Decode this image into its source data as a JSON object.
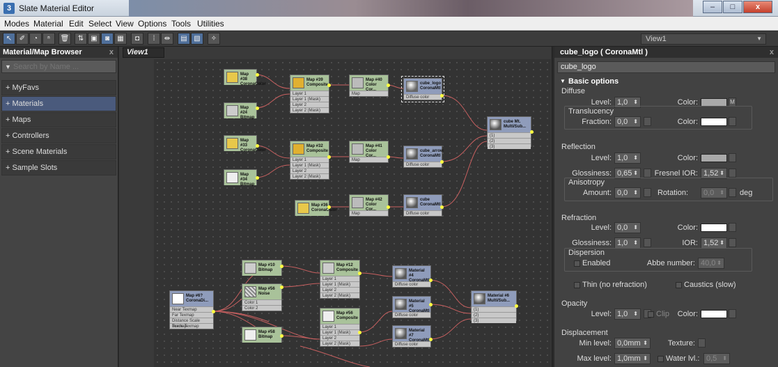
{
  "window": {
    "icon_text": "3",
    "title": "Slate Material Editor",
    "min": "–",
    "max": "□",
    "close": "x"
  },
  "menu": [
    "Modes",
    "Material",
    "Edit",
    "Select",
    "View",
    "Options",
    "Tools",
    "Utilities"
  ],
  "toolbar": {
    "view_selector": "View1"
  },
  "browser": {
    "title": "Material/Map Browser",
    "close": "x",
    "search_placeholder": "Search by Name ...",
    "items": [
      "+ MyFavs",
      "+ Materials",
      "+ Maps",
      "+ Controllers",
      "+ Scene Materials",
      "+ Sample Slots"
    ],
    "selected": 1
  },
  "view": {
    "tab": "View1"
  },
  "nodes": {
    "n1": {
      "title": "Map #38",
      "sub": "CoronaColor"
    },
    "n2": {
      "title": "Map #39",
      "sub": "Composite",
      "rows": [
        "Layer 1",
        "Layer 1 (Mask)",
        "Layer 2",
        "Layer 2 (Mask)"
      ]
    },
    "n3": {
      "title": "Map #40",
      "sub": "Color Cor...",
      "rows": [
        "Map"
      ]
    },
    "n4": {
      "title": "cube_logo",
      "sub": "CoronaMtl",
      "rows": [
        "Diffuse color"
      ]
    },
    "n5": {
      "title": "Map #24",
      "sub": "Bitmap"
    },
    "n6": {
      "title": "cube Mt.",
      "sub": "Multi/Sub...",
      "rows": [
        "(1)",
        "(2)",
        "(3)"
      ]
    },
    "n7": {
      "title": "Map #33",
      "sub": "CoronaColor"
    },
    "n8": {
      "title": "Map #32",
      "sub": "Composite",
      "rows": [
        "Layer 1",
        "Layer 1 (Mask)",
        "Layer 2",
        "Layer 2 (Mask)"
      ]
    },
    "n9": {
      "title": "Map #41",
      "sub": "Color Cor...",
      "rows": [
        "Map"
      ]
    },
    "n10": {
      "title": "cube_arrow",
      "sub": "CoronaMtl",
      "rows": [
        "Diffuse color"
      ]
    },
    "n11": {
      "title": "Map #34",
      "sub": "Bitmap"
    },
    "n12": {
      "title": "Map #42",
      "sub": "Color Cor...",
      "rows": [
        "Map"
      ]
    },
    "n13": {
      "title": "cube",
      "sub": "CoronaMtl",
      "rows": [
        "Diffuse color"
      ]
    },
    "n14": {
      "title": "Map #36",
      "sub": "CoronaColor"
    },
    "n15": {
      "title": "Map #10",
      "sub": "Bitmap"
    },
    "n16": {
      "title": "Map #12",
      "sub": "Composite",
      "rows": [
        "Layer 1",
        "Layer 1 (Mask)",
        "Layer 2",
        "Layer 2 (Mask)"
      ]
    },
    "n17": {
      "title": "Material #4",
      "sub": "CoronaMtl",
      "rows": [
        "Diffuse color"
      ]
    },
    "n18": {
      "title": "Map #6?",
      "sub": "CoronaDi...",
      "rows": [
        "Near Texmap",
        "Far Texmap",
        "Distance Scale Texmap",
        "Inside Texmap"
      ]
    },
    "n19": {
      "title": "Map #56",
      "sub": "Noise",
      "rows": [
        "Color 1",
        "Color 2"
      ]
    },
    "n20": {
      "title": "Material #5",
      "sub": "CoronaMtl",
      "rows": [
        "Diffuse color"
      ]
    },
    "n21": {
      "title": "Material #6",
      "sub": "Multi/Sub...",
      "rows": [
        "(1)",
        "(2)",
        "(3)"
      ]
    },
    "n22": {
      "title": "Map #56",
      "sub": "Composite",
      "rows": [
        "Layer 1",
        "Layer 1 (Mask)",
        "Layer 2",
        "Layer 2 (Mask)"
      ]
    },
    "n23": {
      "title": "Material #7",
      "sub": "CoronaMtl",
      "rows": [
        "Diffuse color"
      ]
    },
    "n24": {
      "title": "Map #58",
      "sub": "Bitmap"
    }
  },
  "props": {
    "title": "cube_logo  ( CoronaMtl )",
    "name_value": "cube_logo",
    "rollout": "Basic options",
    "diffuse": {
      "label": "Diffuse",
      "level_label": "Level:",
      "level": "1,0",
      "color_label": "Color:",
      "map_btn": "M",
      "swatch": "#a9a9a9"
    },
    "translucency": {
      "label": "Translucency",
      "fraction_label": "Fraction:",
      "fraction": "0,0",
      "color_label": "Color:",
      "swatch": "#ffffff"
    },
    "reflection": {
      "label": "Reflection",
      "level_label": "Level:",
      "level": "1,0",
      "color_label": "Color:",
      "swatch": "#a9a9a9",
      "gloss_label": "Glossiness:",
      "gloss": "0,65",
      "fresnel_label": "Fresnel IOR:",
      "fresnel": "1,52"
    },
    "anisotropy": {
      "label": "Anisotropy",
      "amount_label": "Amount:",
      "amount": "0,0",
      "rotation_label": "Rotation:",
      "rotation": "0,0",
      "unit": "deg"
    },
    "refraction": {
      "label": "Refraction",
      "level_label": "Level:",
      "level": "0,0",
      "color_label": "Color:",
      "swatch": "#ffffff",
      "gloss_label": "Glossiness:",
      "gloss": "1,0",
      "ior_label": "IOR:",
      "ior": "1,52"
    },
    "dispersion": {
      "label": "Dispersion",
      "enabled": "Enabled",
      "abbe_label": "Abbe number:",
      "abbe": "40,0"
    },
    "thin": "Thin (no refraction)",
    "caustics": "Caustics (slow)",
    "opacity": {
      "label": "Opacity",
      "level_label": "Level:",
      "level": "1,0",
      "clip": "Clip",
      "color_label": "Color:",
      "swatch": "#ffffff"
    },
    "displacement": {
      "label": "Displacement",
      "min_label": "Min level:",
      "min": "0,0mm",
      "texture_label": "Texture:",
      "max_label": "Max level:",
      "max": "1,0mm",
      "water_label": "Water lvl.:",
      "water": "0,5"
    }
  },
  "colors": {
    "map_node": "#a9c29a",
    "mtl_node": "#8f9cbb",
    "wire": "#c86060",
    "socket": "#ffff40",
    "selection": "#4a5a7c"
  }
}
